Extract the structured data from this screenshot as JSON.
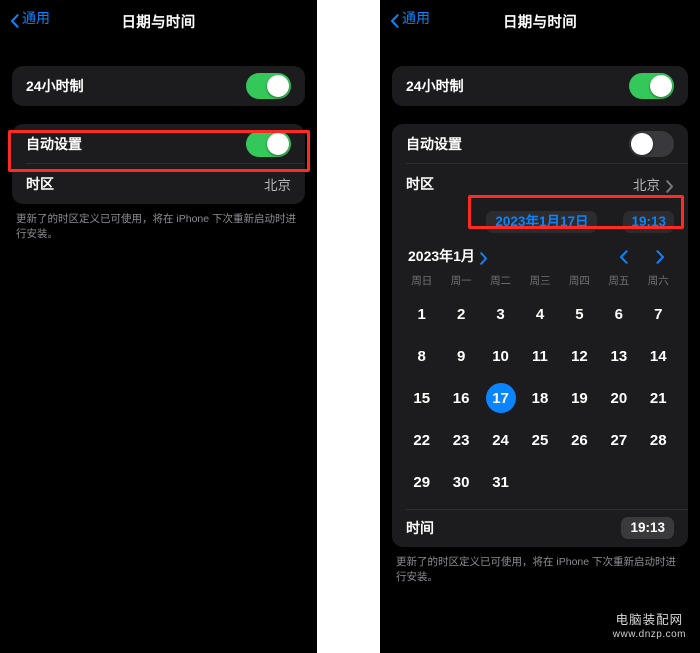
{
  "left_panel": {
    "nav": {
      "back_label": "通用",
      "back_icon": "chevron-left-icon",
      "title": "日期与时间"
    },
    "rows": {
      "hour24_label": "24小时制",
      "hour24_state": "on",
      "auto_label": "自动设置",
      "auto_state": "on",
      "timezone_label": "时区",
      "timezone_value": "北京"
    },
    "footnote": "更新了的时区定义已可使用，将在 iPhone 下次重新启动时进行安装。"
  },
  "right_panel": {
    "nav": {
      "back_label": "通用",
      "back_icon": "chevron-left-icon",
      "title": "日期与时间"
    },
    "rows": {
      "hour24_label": "24小时制",
      "hour24_state": "on",
      "auto_label": "自动设置",
      "auto_state": "off",
      "timezone_label": "时区",
      "timezone_value": "北京"
    },
    "datetime_picker": {
      "date_value": "2023年1月17日",
      "time_value": "19:13"
    },
    "calendar": {
      "month_label": "2023年1月",
      "prev_icon": "chevron-left-icon",
      "next_icon": "chevron-right-icon",
      "weekdays": [
        "周日",
        "周一",
        "周二",
        "周三",
        "周四",
        "周五",
        "周六"
      ],
      "weeks": [
        [
          "1",
          "2",
          "3",
          "4",
          "5",
          "6",
          "7"
        ],
        [
          "8",
          "9",
          "10",
          "11",
          "12",
          "13",
          "14"
        ],
        [
          "15",
          "16",
          "17",
          "18",
          "19",
          "20",
          "21"
        ],
        [
          "22",
          "23",
          "24",
          "25",
          "26",
          "27",
          "28"
        ],
        [
          "29",
          "30",
          "31",
          "",
          "",
          "",
          ""
        ]
      ],
      "selected_day": "17"
    },
    "time_row": {
      "label": "时间",
      "value": "19:13"
    },
    "footnote": "更新了的时区定义已可使用，将在 iPhone 下次重新启动时进行安装。"
  },
  "annotations": {
    "box_color": "#ff2a22",
    "highlight_left": "auto-set-row",
    "highlight_right": "date-time-picker-row"
  },
  "watermark": {
    "name": "电脑装配网",
    "url": "www.dnzp.com"
  },
  "colors": {
    "accent_blue": "#0a84ff",
    "toggle_on": "#34c759",
    "toggle_off": "#39393d",
    "card_bg": "#1c1c1e",
    "page_bg": "#000000"
  }
}
